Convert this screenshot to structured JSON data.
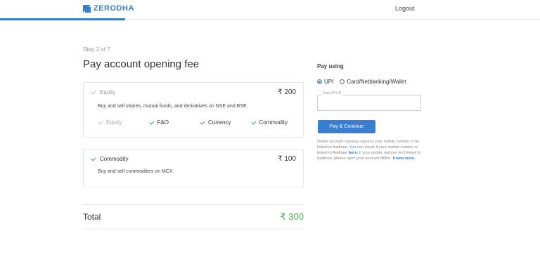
{
  "header": {
    "brand": "ZERODHA",
    "logout_label": "Logout",
    "accent_color": "#387ed1",
    "progress_fraction": 0.23
  },
  "main": {
    "step_text": "Step 2 of 7",
    "title": "Pay account opening fee",
    "equity": {
      "label": "Equity",
      "price": "₹ 200",
      "description": "Buy and sell shares, mutual funds, and derivatives on NSE and BSE.",
      "segments": [
        {
          "label": "Equity",
          "checked": true,
          "disabled": true
        },
        {
          "label": "F&O",
          "checked": true,
          "disabled": false
        },
        {
          "label": "Currency",
          "checked": true,
          "disabled": false
        },
        {
          "label": "Commodity",
          "checked": true,
          "disabled": false
        }
      ]
    },
    "commodity": {
      "label": "Commodity",
      "price": "₹ 100",
      "description": "Buy and sell commodities on MCX."
    },
    "total": {
      "label": "Total",
      "value": "₹ 300",
      "color": "#4caf50"
    }
  },
  "payment": {
    "heading": "Pay using",
    "options": [
      {
        "label": "UPI",
        "selected": true
      },
      {
        "label": "Card/Netbanking/Wallet",
        "selected": false
      }
    ],
    "upi_label": "Your UPI ID",
    "upi_value": "",
    "button_label": "Pay & Continue",
    "info": {
      "part1": "Online account opening requires your mobile number to be linked to Aadhaar. You can check if your mobile number is linked to Aadhaar",
      "link1": "here.",
      "part2": "If your mobile number isn't linked to Aadhaar, please open your account offline.",
      "link2": "Know more."
    }
  }
}
